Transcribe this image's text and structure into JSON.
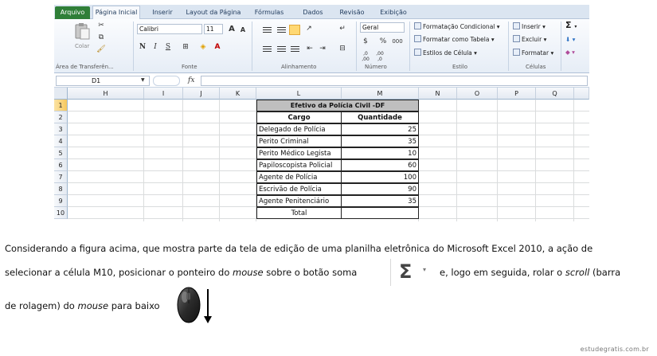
{
  "excel": {
    "file_tab": "Arquivo",
    "tabs": [
      "Página Inicial",
      "Inserir",
      "Layout da Página",
      "Fórmulas",
      "Dados",
      "Revisão",
      "Exibição"
    ],
    "active_tab": "Página Inicial",
    "clipboard": {
      "paste_label": "Colar",
      "group_label": "Área de Transferên..."
    },
    "font": {
      "name": "Calibri",
      "size": "11",
      "group_label": "Fonte",
      "bold": "N",
      "italic": "I",
      "underline": "S",
      "grow": "A",
      "shrink": "A"
    },
    "alignment": {
      "group_label": "Alinhamento"
    },
    "number": {
      "format": "Geral",
      "currency": "$",
      "percent": "%",
      "thousands": "000",
      "inc_decimal": ",0\n,00",
      "dec_decimal": ",00\n,0",
      "group_label": "Número"
    },
    "styles": {
      "conditional": "Formatação Condicional",
      "table": "Formatar como Tabela",
      "cell": "Estilos de Célula",
      "group_label": "Estilo"
    },
    "cells": {
      "insert": "Inserir",
      "delete": "Excluir",
      "format": "Formatar",
      "group_label": "Células"
    },
    "editing": {
      "sum_symbol": "Σ"
    },
    "name_box": "D1",
    "fx_label": "fx",
    "columns": [
      "H",
      "I",
      "J",
      "K",
      "L",
      "M",
      "N",
      "O",
      "P",
      "Q"
    ],
    "rows": [
      "1",
      "2",
      "3",
      "4",
      "5",
      "6",
      "7",
      "8",
      "9",
      "10"
    ],
    "table": {
      "title": "Efetivo da Polícia Civil -DF",
      "header_cargo": "Cargo",
      "header_qtd": "Quantidade",
      "rows": [
        {
          "cargo": "Delegado de Polícia",
          "qtd": "25"
        },
        {
          "cargo": "Perito Criminal",
          "qtd": "35"
        },
        {
          "cargo": "Perito Médico Legista",
          "qtd": "10"
        },
        {
          "cargo": "Papiloscopista Policial",
          "qtd": "60"
        },
        {
          "cargo": "Agente de Polícia",
          "qtd": "100"
        },
        {
          "cargo": "Escrivão de Polícia",
          "qtd": "90"
        },
        {
          "cargo": "Agente Penitenciário",
          "qtd": "35"
        }
      ],
      "total_label": "Total",
      "total_value": ""
    }
  },
  "question": {
    "line1": "Considerando a figura acima, que mostra parte da tela de edição de uma planilha eletrônica do Microsoft Excel 2010, a ação de",
    "line2_a": "selecionar a célula M10, posicionar o ponteiro do ",
    "line2_mouse": "mouse",
    "line2_b": " sobre o botão soma",
    "line2_c": "e, logo em seguida, rolar o ",
    "line2_scroll": "scroll",
    "line2_d": " (barra",
    "line3_a": "de rolagem) do ",
    "line3_mouse": "mouse",
    "line3_b": " para baixo",
    "sum_symbol": "Σ",
    "sum_dropdown": "▾"
  },
  "footer": "estudegratis.com.br"
}
